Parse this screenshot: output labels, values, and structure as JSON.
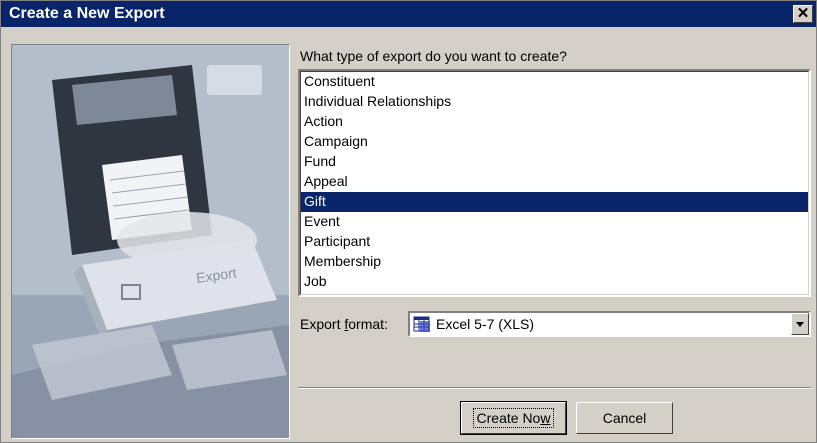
{
  "window": {
    "title": "Create a New Export",
    "close_glyph": "✕"
  },
  "picture": {
    "key_label": "Export"
  },
  "prompt": "What type of export do you want to create?",
  "export_types": [
    "Constituent",
    "Individual Relationships",
    "Action",
    "Campaign",
    "Fund",
    "Appeal",
    "Gift",
    "Event",
    "Participant",
    "Membership",
    "Job"
  ],
  "selected_type": "Gift",
  "export_format": {
    "label_prefix": "Export ",
    "label_accel": "f",
    "label_suffix": "ormat:",
    "value": "Excel 5-7 (XLS)",
    "icon": "excel-icon"
  },
  "buttons": {
    "create_prefix": "Create No",
    "create_accel": "w",
    "cancel": "Cancel"
  },
  "colors": {
    "title_bar": "#0a246a",
    "selection": "#0a246a",
    "face": "#d4d0c8"
  }
}
